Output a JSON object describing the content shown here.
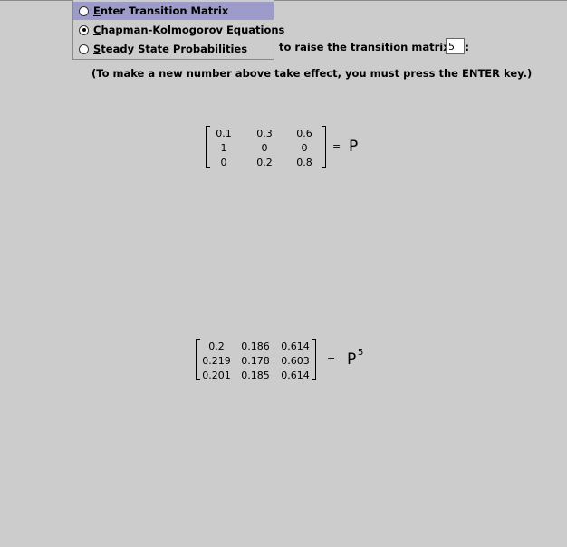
{
  "menu": {
    "items": [
      {
        "label_pre": "",
        "mnemonic": "E",
        "label_post": "nter Transition Matrix",
        "selected": true,
        "checked": false
      },
      {
        "label_pre": "",
        "mnemonic": "C",
        "label_post": "hapman-Kolmogorov Equations",
        "selected": false,
        "checked": true
      },
      {
        "label_pre": "",
        "mnemonic": "S",
        "label_post": "teady State Probabilities",
        "selected": false,
        "checked": false
      }
    ]
  },
  "power": {
    "label": "to raise the transition matrix, P:",
    "value": "5"
  },
  "hint": "(To make a new number above take effect, you must press the ENTER key.)",
  "matrix_p": {
    "rows": [
      [
        "0.1",
        "0.3",
        "0.6"
      ],
      [
        "1",
        "0",
        "0"
      ],
      [
        "0",
        "0.2",
        "0.8"
      ]
    ],
    "equals": "=",
    "name": "P"
  },
  "matrix_pn": {
    "rows": [
      [
        "0.2",
        "0.186",
        "0.614"
      ],
      [
        "0.219",
        "0.178",
        "0.603"
      ],
      [
        "0.201",
        "0.185",
        "0.614"
      ]
    ],
    "equals": "=",
    "name": "P",
    "exponent": "5"
  },
  "colors": {
    "background": "#cccccc",
    "menu_highlight": "#9d9bc9"
  }
}
